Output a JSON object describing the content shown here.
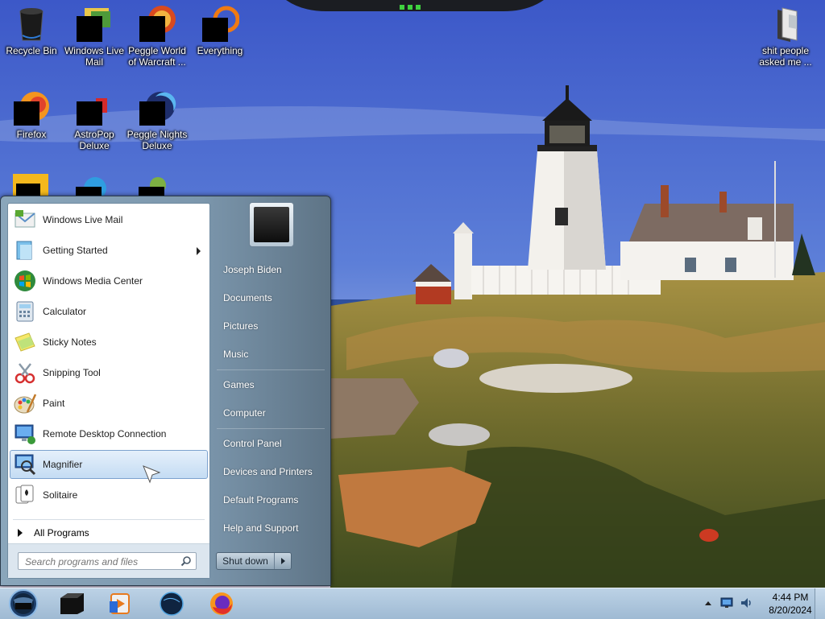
{
  "desktop": {
    "icons": [
      {
        "label": "Recycle Bin"
      },
      {
        "label": "Windows Live Mail"
      },
      {
        "label": "Peggle World of Warcraft ..."
      },
      {
        "label": "Everything"
      },
      {
        "label": "Firefox"
      },
      {
        "label": "AstroPop Deluxe"
      },
      {
        "label": "Peggle Nights Deluxe"
      },
      {
        "label": "shit people asked me ..."
      }
    ]
  },
  "start_menu": {
    "programs": [
      {
        "label": "Windows Live Mail",
        "icon": "mail-icon"
      },
      {
        "label": "Getting Started",
        "icon": "getting-started-icon",
        "has_submenu": true
      },
      {
        "label": "Windows Media Center",
        "icon": "media-center-icon"
      },
      {
        "label": "Calculator",
        "icon": "calculator-icon"
      },
      {
        "label": "Sticky Notes",
        "icon": "sticky-notes-icon"
      },
      {
        "label": "Snipping Tool",
        "icon": "scissors-icon"
      },
      {
        "label": "Paint",
        "icon": "paint-palette-icon"
      },
      {
        "label": "Remote Desktop Connection",
        "icon": "remote-desktop-icon"
      },
      {
        "label": "Magnifier",
        "icon": "magnifier-icon",
        "selected": true
      },
      {
        "label": "Solitaire",
        "icon": "playing-cards-icon"
      }
    ],
    "all_programs_label": "All Programs",
    "search_placeholder": "Search programs and files",
    "right_items": [
      {
        "label": "Joseph Biden"
      },
      {
        "label": "Documents"
      },
      {
        "label": "Pictures"
      },
      {
        "label": "Music"
      },
      {
        "label": "Games"
      },
      {
        "label": "Computer"
      },
      {
        "label": "Control Panel"
      },
      {
        "label": "Devices and Printers"
      },
      {
        "label": "Default Programs"
      },
      {
        "label": "Help and Support"
      }
    ],
    "shutdown_label": "Shut down"
  },
  "taskbar": {
    "pinned": [
      {
        "name": "app-icon"
      },
      {
        "name": "media-player-icon"
      },
      {
        "name": "globe-icon"
      },
      {
        "name": "firefox-icon"
      }
    ],
    "clock": {
      "time": "4:44 PM",
      "date": "8/20/2024"
    }
  },
  "colors": {
    "selection_bg": "#c4dcf3",
    "taskbar": "#a9c3da",
    "start_menu_glass": "#7c97ad"
  }
}
